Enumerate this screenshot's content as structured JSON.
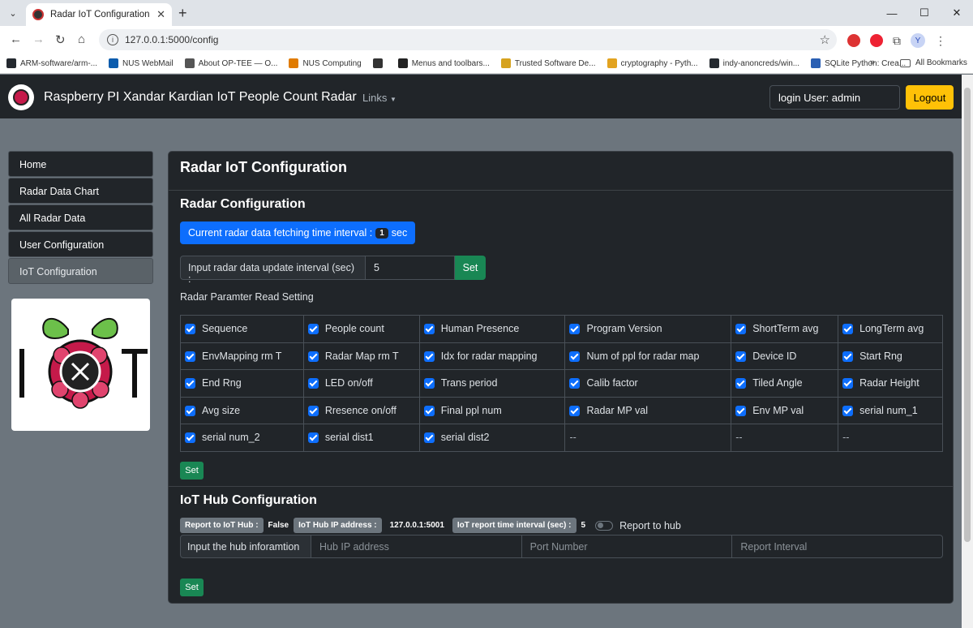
{
  "browser": {
    "tab_title": "Radar IoT Configuration",
    "url": "127.0.0.1:5000/config",
    "bookmarks": [
      {
        "label": "ARM-software/arm-...",
        "color": "#24292f"
      },
      {
        "label": "NUS WebMail",
        "color": "#0b5cad"
      },
      {
        "label": "About OP-TEE — O...",
        "color": "#555555"
      },
      {
        "label": "NUS Computing",
        "color": "#e07b00"
      },
      {
        "label": "",
        "color": "#333333"
      },
      {
        "label": "Menus and toolbars...",
        "color": "#222222"
      },
      {
        "label": "Trusted Software De...",
        "color": "#d6a21e"
      },
      {
        "label": "cryptography - Pyth...",
        "color": "#e2a320"
      },
      {
        "label": "indy-anoncreds/win...",
        "color": "#24292f"
      },
      {
        "label": "SQLite Python: Crea...",
        "color": "#2a5fb3"
      }
    ],
    "all_bookmarks": "All Bookmarks",
    "profile_initial": "Y"
  },
  "navbar": {
    "brand": "Raspberry PI Xandar Kardian IoT People Count Radar",
    "links": "Links",
    "login_user": "login User: admin",
    "logout": "Logout"
  },
  "sidebar": {
    "items": [
      {
        "label": "Home"
      },
      {
        "label": "Radar Data Chart"
      },
      {
        "label": "All Radar Data"
      },
      {
        "label": "User Configuration"
      },
      {
        "label": "IoT Configuration"
      }
    ]
  },
  "main": {
    "title": "Radar IoT Configuration",
    "radar_section_title": "Radar Configuration",
    "fetch_interval_prefix": "Current radar data fetching time interval :",
    "fetch_interval_value": "1",
    "fetch_interval_unit": "sec",
    "update_interval_label": "Input radar data update interval (sec) :",
    "update_interval_value": "5",
    "set_label": "Set",
    "param_setting_label": "Radar Paramter Read Setting",
    "params": [
      [
        "Sequence",
        "People count",
        "Human Presence",
        "Program Version",
        "ShortTerm avg",
        "LongTerm avg"
      ],
      [
        "EnvMapping rm T",
        "Radar Map rm T",
        "Idx for radar mapping",
        "Num of ppl for radar map",
        "Device ID",
        "Start Rng"
      ],
      [
        "End Rng",
        "LED on/off",
        "Trans period",
        "Calib factor",
        "Tiled Angle",
        "Radar Height"
      ],
      [
        "Avg size",
        "Rresence on/off",
        "Final ppl num",
        "Radar MP val",
        "Env MP val",
        "serial num_1"
      ],
      [
        "serial num_2",
        "serial dist1",
        "serial dist2",
        "--",
        "--",
        "--"
      ]
    ],
    "iot_section_title": "IoT Hub Configuration",
    "report_to_hub_label": "Report to IoT Hub :",
    "report_to_hub_value": "False",
    "hub_ip_label": "IoT Hub IP address :",
    "hub_ip_value": "127.0.0.1:5001",
    "report_interval_label": "IoT report time interval (sec) :",
    "report_interval_value": "5",
    "report_switch_label": "Report to hub",
    "hub_input_label": "Input the hub inforamtion",
    "hub_ip_placeholder": "Hub IP address",
    "port_placeholder": "Port Number",
    "interval_placeholder": "Report Interval"
  }
}
